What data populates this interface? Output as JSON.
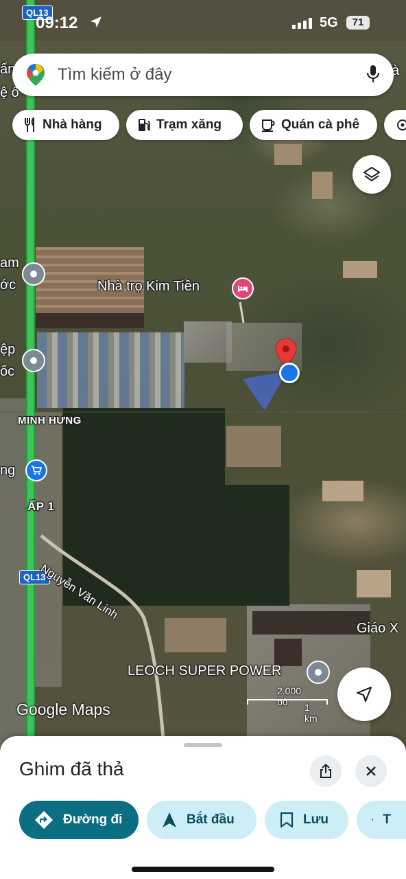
{
  "status_bar": {
    "time": "09:12",
    "network": "5G",
    "battery": "71"
  },
  "search": {
    "placeholder": "Tìm kiếm ở đây"
  },
  "chips": [
    {
      "label": "Nhà hàng",
      "icon": "restaurant-icon"
    },
    {
      "label": "Trạm xăng",
      "icon": "gas-station-icon"
    },
    {
      "label": "Quán cà phê",
      "icon": "coffee-icon"
    }
  ],
  "map": {
    "labels": {
      "road_top": "QL13",
      "road_mid": "QL13",
      "place_kim_tien": "Nhà trọ Kim Tiền",
      "minh_hung": "MINH HƯNG",
      "ap1": "ẤP 1",
      "nguyen_van_linh": "Nguyễn Văn Linh",
      "leoch": "LEOCH SUPER POWER",
      "giao": "Giáo X",
      "left_1": "ấn",
      "left_2": "ệ ô",
      "left_3": "am",
      "left_4": "ớc",
      "left_5": "ệp",
      "left_6": "ốc",
      "left_7": "ng",
      "right_top": "gà"
    },
    "scale": {
      "imperial": "2.000 bộ",
      "metric": "1 km"
    },
    "watermark": "Google Maps"
  },
  "sheet": {
    "title": "Ghim đã thả",
    "actions": [
      {
        "label": "Đường đi"
      },
      {
        "label": "Bắt đầu"
      },
      {
        "label": "Lưu"
      },
      {
        "label": "T"
      }
    ]
  }
}
